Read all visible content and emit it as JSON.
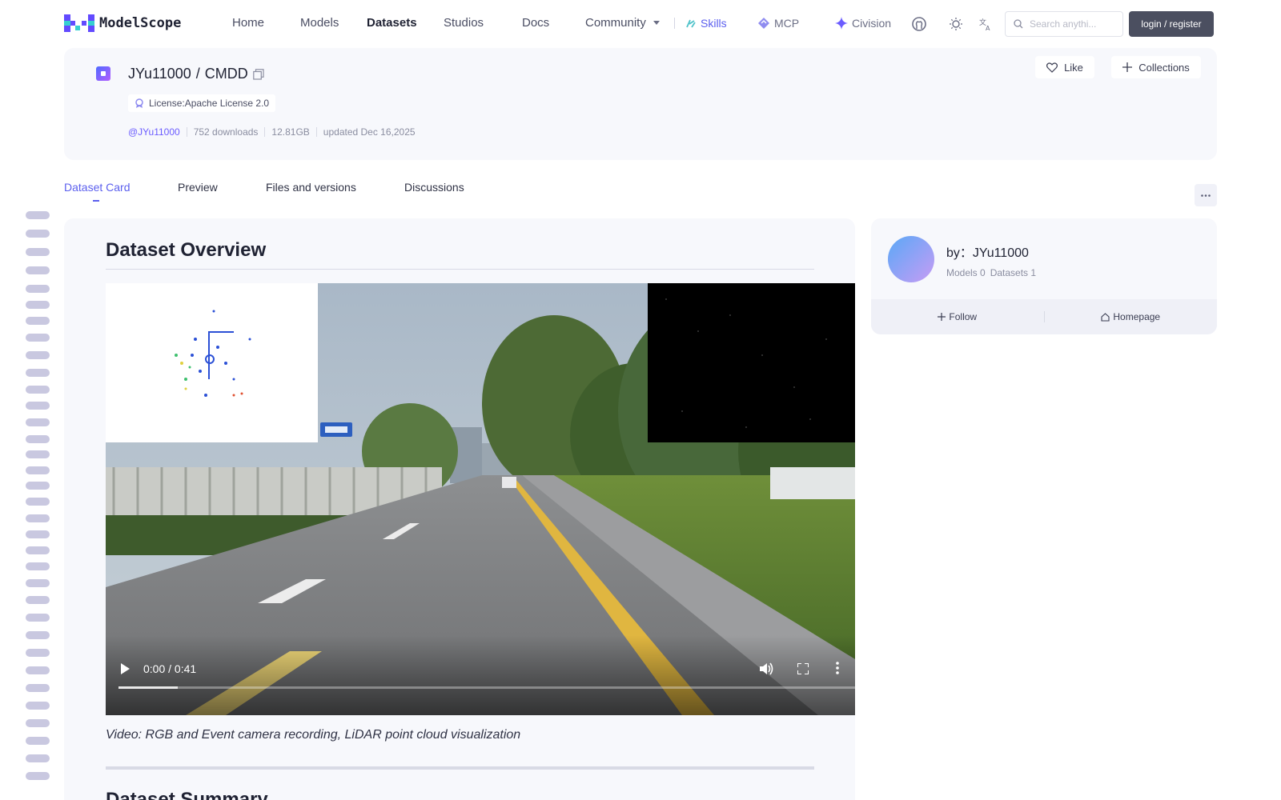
{
  "brand": {
    "logo_text": "ModelScope"
  },
  "nav": {
    "items": [
      "Home",
      "Models",
      "Datasets",
      "Studios",
      "Docs",
      "Community"
    ],
    "active": "Datasets",
    "extras": [
      {
        "label": "Skills",
        "color": "#5b5fee",
        "icon": "skills-icon"
      },
      {
        "label": "MCP",
        "color": "#6b6e85",
        "icon": "mcp-icon"
      },
      {
        "label": "Civision",
        "color": "#6b6e85",
        "icon": "sparkle-icon"
      }
    ],
    "search_placeholder": "Search anythi...",
    "login_label": "login / register"
  },
  "repo": {
    "owner": "JYu11000",
    "separator": "/",
    "name": "CMDD",
    "license": "License:Apache License 2.0",
    "author_handle": "@JYu11000",
    "downloads": "752 downloads",
    "size": "12.81GB",
    "updated": "updated Dec 16,2025",
    "like_label": "Like",
    "collections_label": "Collections"
  },
  "tabs": [
    "Dataset Card",
    "Preview",
    "Files and versions",
    "Discussions"
  ],
  "active_tab": "Dataset Card",
  "content": {
    "overview_heading": "Dataset Overview",
    "video": {
      "time": "0:00 / 0:41",
      "progress": 0.08
    },
    "caption": "Video: RGB and Event camera recording, LiDAR point cloud visualization",
    "summary_heading": "Dataset Summary"
  },
  "author_card": {
    "by_label": "by：JYu11000",
    "models": "Models 0",
    "datasets": "Datasets 1",
    "follow_label": "Follow",
    "homepage_label": "Homepage"
  },
  "colors": {
    "accent": "#5b5fee",
    "card_bg": "#f7f8fc",
    "login_bg": "#4b4f60"
  }
}
